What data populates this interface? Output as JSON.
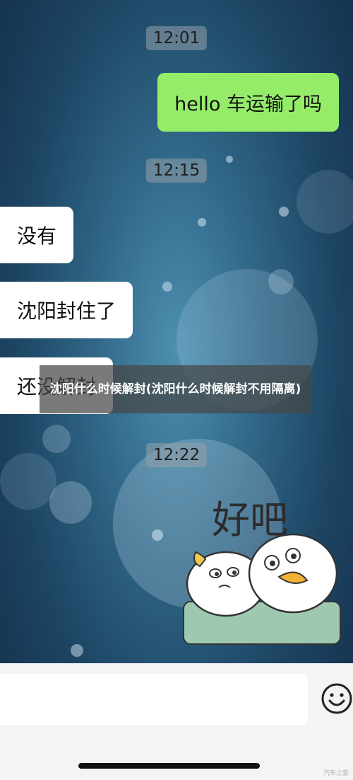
{
  "messages": {
    "time1": "12:01",
    "sent_text": "hello  车运输了吗",
    "time2": "12:15",
    "recv1": "没有",
    "recv2": "沈阳封住了",
    "recv3": "还没解封",
    "time3": "12:22",
    "sticker_text": "好吧"
  },
  "caption": {
    "text": "沈阳什么时候解封(沈阳什么时候解封不用隔离)"
  },
  "input_bar": {
    "emoji_icon": "emoji-smiley-icon"
  },
  "watermark": "汽车之家",
  "colors": {
    "sent_bubble": "#95ec69",
    "received_bubble": "#ffffff",
    "time_badge": "#96a0aa"
  }
}
